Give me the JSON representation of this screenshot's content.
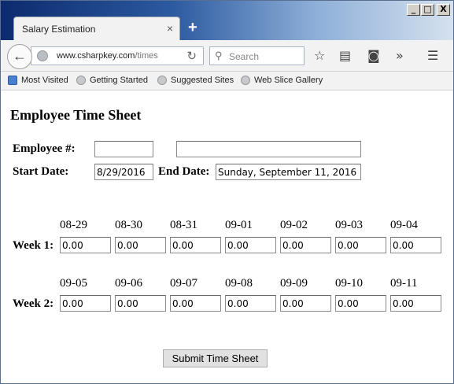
{
  "browser": {
    "tab_title": "Salary Estimation",
    "tab_close": "×",
    "new_tab": "+",
    "url_domain": "www.csharpkey.com",
    "url_path": "/times",
    "search_placeholder": "Search",
    "window_controls": {
      "minimize": "_",
      "maximize": "□",
      "close": "X"
    }
  },
  "bookmarks": [
    {
      "label": "Most Visited"
    },
    {
      "label": "Getting Started"
    },
    {
      "label": "Suggested Sites"
    },
    {
      "label": "Web Slice Gallery"
    }
  ],
  "page": {
    "title": "Employee Time Sheet",
    "employee_label": "Employee #:",
    "employee_number": "",
    "employee_name": "",
    "start_label": "Start Date:",
    "start_date": "8/29/2016",
    "end_label": "End Date:",
    "end_date": "Sunday, September 11, 2016",
    "week1": {
      "label": "Week 1:",
      "days": [
        "08-29",
        "08-30",
        "08-31",
        "09-01",
        "09-02",
        "09-03",
        "09-04"
      ],
      "hours": [
        "0.00",
        "0.00",
        "0.00",
        "0.00",
        "0.00",
        "0.00",
        "0.00"
      ]
    },
    "week2": {
      "label": "Week 2:",
      "days": [
        "09-05",
        "09-06",
        "09-07",
        "09-08",
        "09-09",
        "09-10",
        "09-11"
      ],
      "hours": [
        "0.00",
        "0.00",
        "0.00",
        "0.00",
        "0.00",
        "0.00",
        "0.00"
      ]
    },
    "submit_label": "Submit Time Sheet"
  }
}
